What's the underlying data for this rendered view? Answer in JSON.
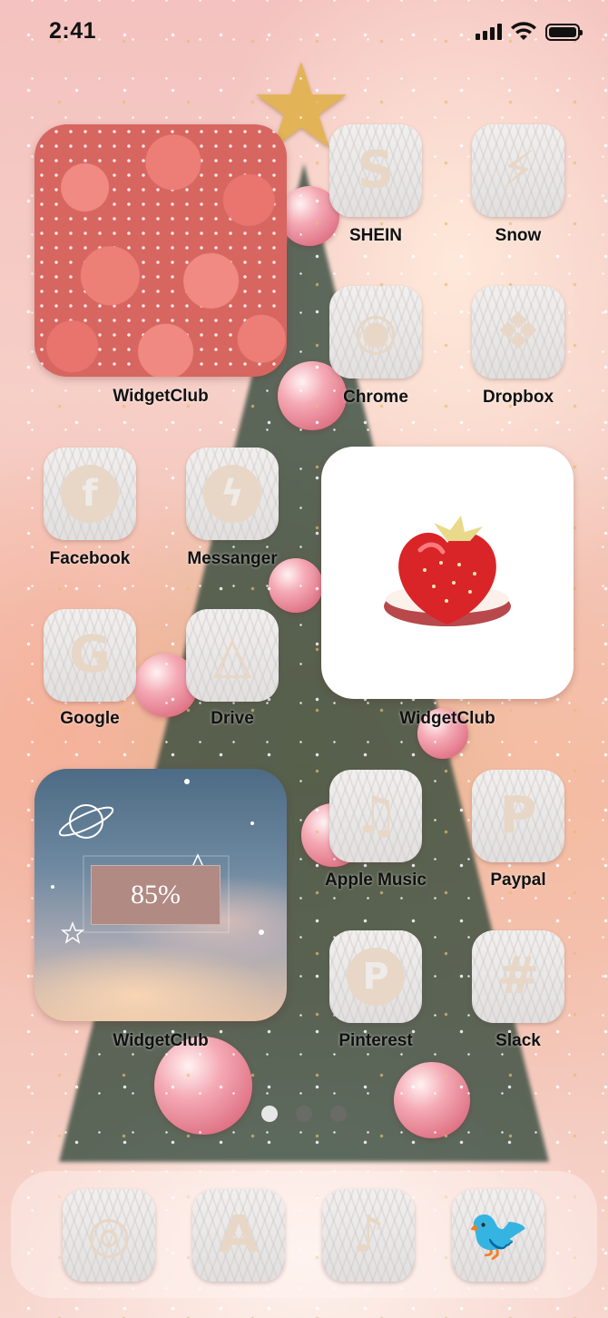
{
  "status_bar": {
    "time": "2:41"
  },
  "apps": [
    {
      "label": "SHEIN",
      "icon": "shein-icon",
      "glyph": "S"
    },
    {
      "label": "Snow",
      "icon": "snow-icon",
      "glyph": "⚡"
    },
    {
      "label": "Chrome",
      "icon": "chrome-icon",
      "glyph": "◉"
    },
    {
      "label": "Dropbox",
      "icon": "dropbox-icon",
      "glyph": "❖"
    },
    {
      "label": "Facebook",
      "icon": "facebook-icon",
      "glyph": "f"
    },
    {
      "label": "Messanger",
      "icon": "messenger-icon",
      "glyph": "ϟ"
    },
    {
      "label": "Google",
      "icon": "google-icon",
      "glyph": "G"
    },
    {
      "label": "Drive",
      "icon": "drive-icon",
      "glyph": "△"
    },
    {
      "label": "Apple Music",
      "icon": "music-icon",
      "glyph": "♫"
    },
    {
      "label": "Paypal",
      "icon": "paypal-icon",
      "glyph": "P"
    },
    {
      "label": "Pinterest",
      "icon": "pinterest-icon",
      "glyph": "P"
    },
    {
      "label": "Slack",
      "icon": "slack-icon",
      "glyph": "#"
    }
  ],
  "widgets": [
    {
      "label": "WidgetClub",
      "kind": "strawberry-pattern-photo"
    },
    {
      "label": "WidgetClub",
      "kind": "strawberry-cake-photo"
    },
    {
      "label": "WidgetClub",
      "kind": "battery-widget",
      "battery_text": "85%"
    }
  ],
  "dock": [
    {
      "icon": "instagram-icon",
      "glyph": "◎"
    },
    {
      "icon": "app-store-icon",
      "glyph": "A"
    },
    {
      "icon": "tiktok-icon",
      "glyph": "♪"
    },
    {
      "icon": "twitter-icon",
      "glyph": "🐦"
    }
  ],
  "page_dots": {
    "count": 3,
    "active_index": 0
  },
  "colors": {
    "icon_glyph": "#e8d7c6",
    "icon_tile": "#f2f0ef",
    "label_text": "#111111",
    "battery_box": "#b08a83"
  }
}
